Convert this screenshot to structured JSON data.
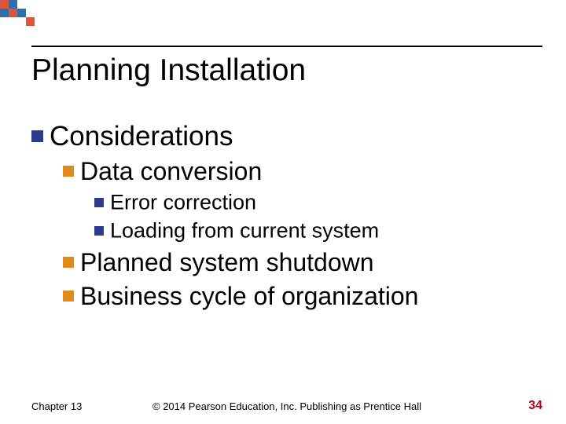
{
  "title": "Planning Installation",
  "bullets": [
    {
      "text": "Considerations",
      "children": [
        {
          "text": "Data conversion",
          "children": [
            {
              "text": "Error correction"
            },
            {
              "text": "Loading from current system"
            }
          ]
        },
        {
          "text": "Planned system shutdown"
        },
        {
          "text": "Business cycle of organization"
        }
      ]
    }
  ],
  "footer": {
    "left": "Chapter 13",
    "center": "© 2014 Pearson Education, Inc. Publishing as Prentice Hall",
    "page": "34"
  },
  "colors": {
    "bullet_navy": "#2e3a8c",
    "bullet_orange": "#e08a1a",
    "page_number": "#b00020"
  }
}
